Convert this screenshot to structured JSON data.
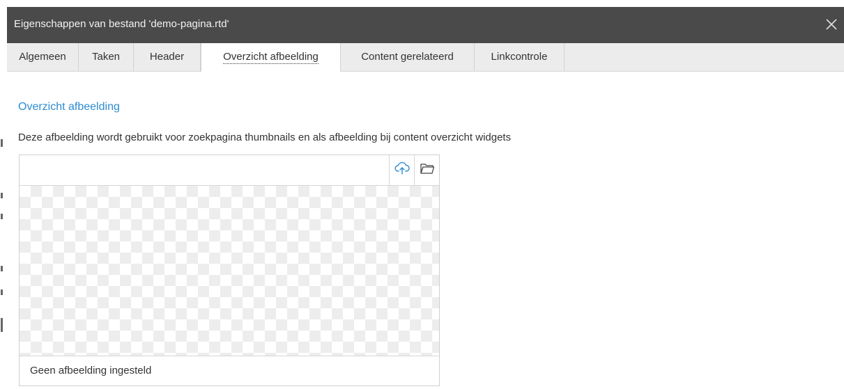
{
  "dialog": {
    "title": "Eigenschappen van bestand 'demo-pagina.rtd'",
    "close_icon": "close-icon"
  },
  "tabs": [
    {
      "label": "Algemeen",
      "active": false
    },
    {
      "label": "Taken",
      "active": false
    },
    {
      "label": "Header",
      "active": false
    },
    {
      "label": "Overzicht afbeelding",
      "active": true
    },
    {
      "label": "Content gerelateerd",
      "active": false
    },
    {
      "label": "Linkcontrole",
      "active": false
    }
  ],
  "section": {
    "heading": "Overzicht afbeelding",
    "description": "Deze afbeelding wordt gebruikt voor zoekpagina thumbnails en als afbeelding bij content overzicht widgets"
  },
  "image_panel": {
    "upload_icon": "cloud-upload-icon",
    "browse_icon": "folder-icon",
    "status": "Geen afbeelding ingesteld"
  },
  "colors": {
    "titlebar_bg": "#4a4a4a",
    "tabbar_bg": "#ececec",
    "heading_accent": "#2d8ad0",
    "upload_icon_color": "#2d8ad0"
  }
}
